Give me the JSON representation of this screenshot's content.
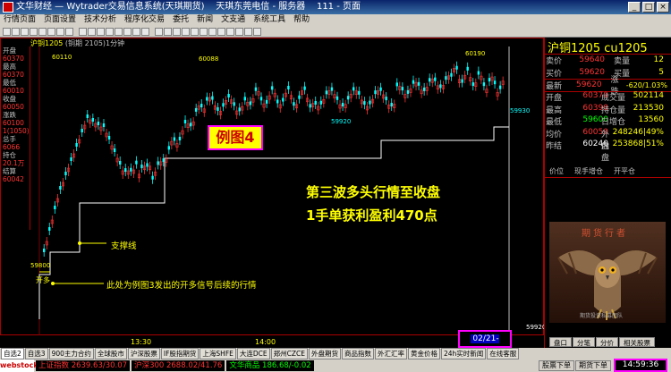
{
  "window": {
    "title": "文华财经 — Wytrader交易信息系统(天琪期货)    天琪东莞电信 - 服务器    111 - 页面",
    "minimize": "_",
    "maximize": "□",
    "close": "×"
  },
  "menu": [
    "行情页面",
    "页面设置",
    "技术分析",
    "程序化交易",
    "委托",
    "新闻",
    "文支通",
    "系统工具",
    "帮助"
  ],
  "chart": {
    "header_symbol": "沪铜1205",
    "header_rest": "(铜期 2105)1分钟",
    "left_col": [
      {
        "label": "开盘",
        "value": ""
      },
      {
        "label": "",
        "value": "60370"
      },
      {
        "label": "最高",
        "value": ""
      },
      {
        "label": "",
        "value": "60370"
      },
      {
        "label": "最低",
        "value": ""
      },
      {
        "label": "",
        "value": "60010"
      },
      {
        "label": "收盘",
        "value": ""
      },
      {
        "label": "",
        "value": "60050"
      },
      {
        "label": "涨跌",
        "value": ""
      },
      {
        "label": "",
        "value": "60100"
      },
      {
        "label": "",
        "value": "1(1050)"
      },
      {
        "label": "总手",
        "value": ""
      },
      {
        "label": "",
        "value": "6066"
      },
      {
        "label": "持仓",
        "value": ""
      },
      {
        "label": "",
        "value": "20.1万"
      },
      {
        "label": "结算",
        "value": ""
      },
      {
        "label": "",
        "value": "60042"
      }
    ],
    "price_labels": {
      "high1": "60110",
      "high2": "60088",
      "high3": "60190",
      "low1": "59920",
      "low2": "59930",
      "start": "59800",
      "scale_bottom": "59920"
    },
    "annotation_box": "例图4",
    "annotation_main_1": "第三波多头行情至收盘",
    "annotation_main_2": "1手单获利盈利470点",
    "support_label": "支撑线",
    "open_marker": "开多",
    "signal_note": "此处为例图3发出的开多信号后续的行情",
    "time_ticks": [
      "13:30",
      "14:00"
    ],
    "cursor_time": "02/21-14:59"
  },
  "quote": {
    "title": "沪铜1205   cu1205",
    "rows": [
      {
        "label": "卖价",
        "value": "59640",
        "cls": "red",
        "label2": "卖量",
        "vol": "12"
      },
      {
        "label": "买价",
        "value": "59620",
        "cls": "red",
        "label2": "买量",
        "vol": "5"
      },
      {
        "label": "最新",
        "value": "59620",
        "cls": "red",
        "label2": "涨跌",
        "vol": "-620/1.03%"
      }
    ],
    "stats_left": [
      {
        "label": "开盘",
        "value": "60370",
        "cls": "red"
      },
      {
        "label": "最高",
        "value": "60390",
        "cls": "red"
      },
      {
        "label": "最低",
        "value": "59600",
        "cls": "green"
      },
      {
        "label": "均价",
        "value": "60050",
        "cls": "red"
      },
      {
        "label": "昨结",
        "value": "60240",
        "cls": "white"
      }
    ],
    "stats_right": [
      {
        "label": "成交量",
        "value": "502114"
      },
      {
        "label": "持仓量",
        "value": "213530"
      },
      {
        "label": "日增仓",
        "value": "13560"
      },
      {
        "label": "外盘",
        "value": "248246|49%"
      },
      {
        "label": "内盘",
        "value": "253868|51%"
      }
    ],
    "subtabs": [
      "价位",
      "现手增仓",
      "开平仓"
    ],
    "owl_title": "期货行者",
    "owl_credit": "期货投资私募团队",
    "tabs": [
      "盘口",
      "分笔",
      "分价",
      "相关股票"
    ]
  },
  "tabs": [
    "自选2",
    "自选3",
    "900主力合约",
    "全球股市",
    "沪深股票",
    "IF股指期货",
    "上海SHFE",
    "大连DCE",
    "郑州CZCE",
    "外盘期货",
    "商品指数",
    "外汇汇率",
    "黄金价格",
    "24h实时新闻",
    "在线客服"
  ],
  "status": {
    "logo": "webstock",
    "items": [
      {
        "text": "上证指数 2639.63/30.07",
        "cls": "red"
      },
      {
        "text": "沪深300 2688.02/41.76",
        "cls": "red"
      },
      {
        "text": "文华商品 186.68/-0.02",
        "cls": "green"
      }
    ],
    "buttons": [
      "股票下单",
      "期货下单"
    ],
    "clock": "14:59:36"
  },
  "colors": {
    "accent": "#ffff00",
    "up": "#ff3333",
    "down": "#00ff00",
    "highlight": "#ff00ff"
  }
}
